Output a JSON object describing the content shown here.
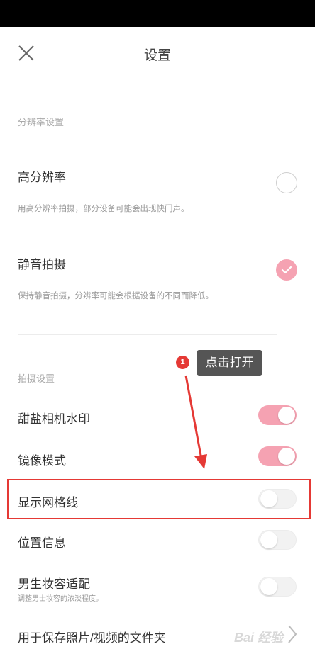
{
  "header": {
    "title": "设置"
  },
  "sections": {
    "resolution_label": "分辨率设置",
    "capture_label": "拍摄设置"
  },
  "items": {
    "high_res": {
      "title": "高分辨率",
      "desc": "用高分辨率拍摄，部分设备可能会出现快门声。",
      "checked": false
    },
    "silent": {
      "title": "静音拍摄",
      "desc": "保持静音拍摄，分辨率可能会根据设备的不同而降低。",
      "checked": true
    },
    "watermark": {
      "title": "甜盐相机水印",
      "on": true
    },
    "mirror": {
      "title": "镜像模式",
      "on": true
    },
    "grid": {
      "title": "显示网格线",
      "on": false
    },
    "location": {
      "title": "位置信息",
      "on": false
    },
    "male_makeup": {
      "title": "男生妆容适配",
      "desc": "调整男士妆容的浓淡程度。",
      "on": false
    },
    "save_folder": {
      "title": "用于保存照片/视频的文件夹"
    }
  },
  "annotation": {
    "step_number": "1",
    "tooltip_text": "点击打开",
    "color": "#e53935"
  },
  "watermark_text": "Bai 经验",
  "colors": {
    "accent": "#f5a2b2",
    "status_bar": "#000000",
    "annotation_red": "#e53935"
  }
}
